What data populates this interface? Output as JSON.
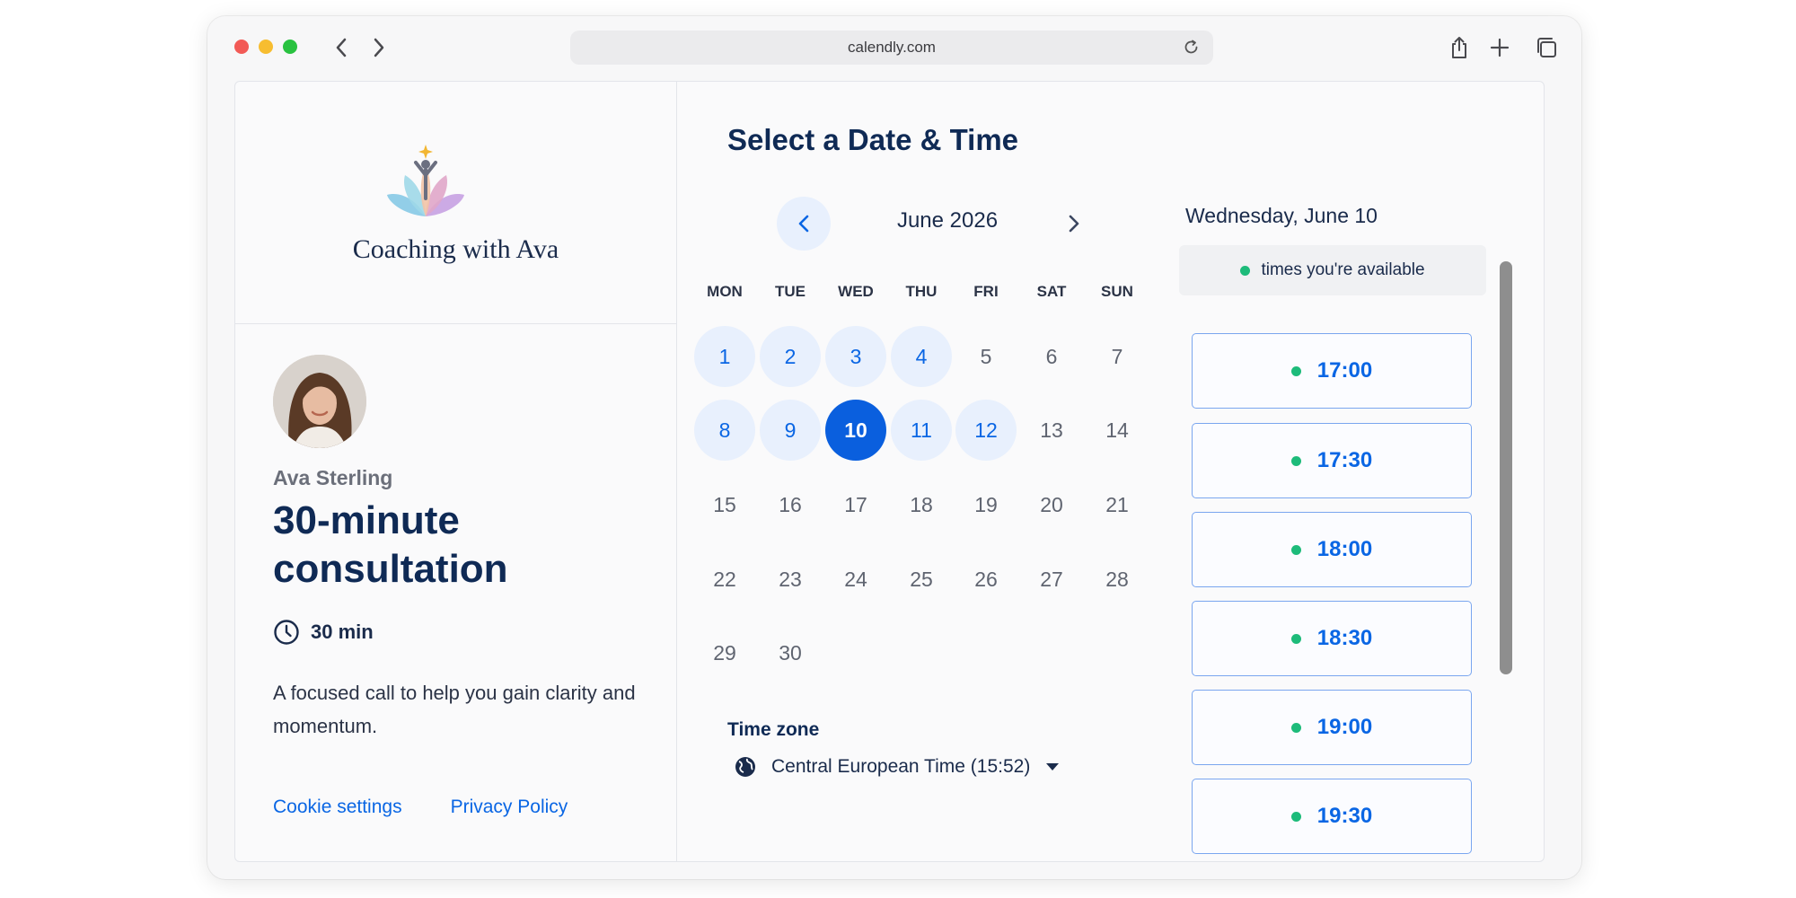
{
  "browser": {
    "url": "calendly.com"
  },
  "brand": {
    "name": "Coaching with Ava"
  },
  "event": {
    "host": "Ava Sterling",
    "title": "30-minute consultation",
    "duration": "30 min",
    "description": "A focused call to help you gain clarity and momentum."
  },
  "footer": {
    "cookie_settings": "Cookie settings",
    "privacy_policy": "Privacy Policy"
  },
  "calendar": {
    "heading": "Select a Date & Time",
    "month": "June 2026",
    "weekdays": [
      "MON",
      "TUE",
      "WED",
      "THU",
      "FRI",
      "SAT",
      "SUN"
    ],
    "days": [
      "1",
      "2",
      "3",
      "4",
      "5",
      "6",
      "7",
      "8",
      "9",
      "10",
      "11",
      "12",
      "13",
      "14",
      "15",
      "16",
      "17",
      "18",
      "19",
      "20",
      "21",
      "22",
      "23",
      "24",
      "25",
      "26",
      "27",
      "28",
      "29",
      "30"
    ],
    "available_days": [
      "1",
      "2",
      "3",
      "4",
      "8",
      "9",
      "11",
      "12"
    ],
    "selected_day": "10"
  },
  "timezone": {
    "label": "Time zone",
    "value": "Central European Time (15:52)"
  },
  "slots": {
    "date_heading": "Wednesday, June 10",
    "legend": "times you're available",
    "times": [
      "17:00",
      "17:30",
      "18:00",
      "18:30",
      "19:00",
      "19:30"
    ]
  },
  "colors": {
    "accent": "#0a66e4",
    "selected": "#0a5fde",
    "available_bg": "#e8f0fd",
    "availability_dot": "#1dbb7a",
    "heading": "#0f2a55"
  }
}
